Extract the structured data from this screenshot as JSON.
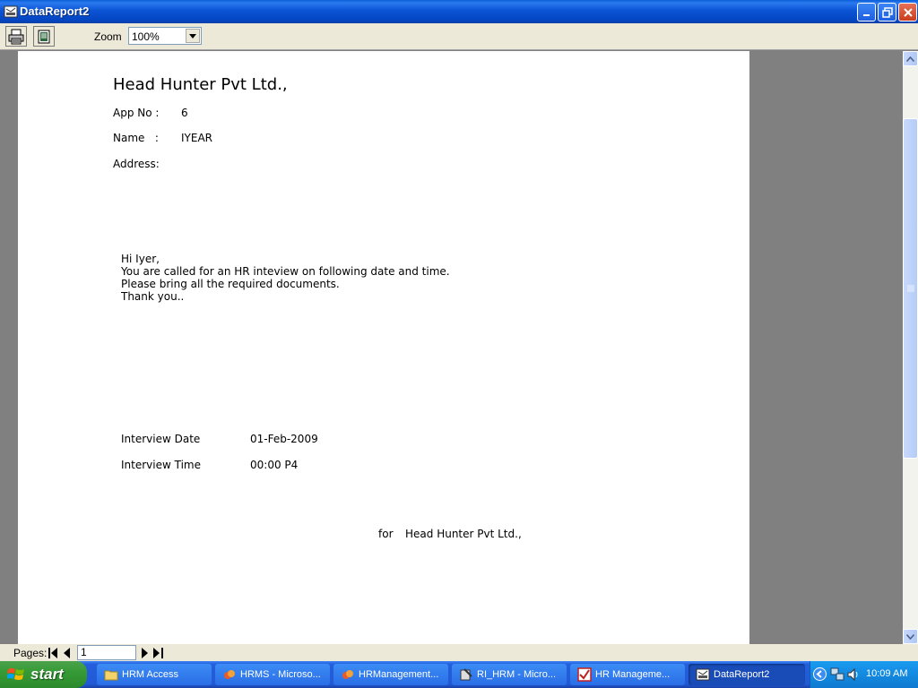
{
  "window": {
    "title": "DataReport2"
  },
  "toolbar": {
    "print_icon": "printer-icon",
    "export_icon": "export-icon",
    "zoom_label": "Zoom",
    "zoom_value": "100%"
  },
  "report": {
    "company": "Head Hunter Pvt Ltd.,",
    "app_no_label": "App No :",
    "app_no_value": "6",
    "name_label": "Name   :",
    "name_value": "IYEAR",
    "address_label": "Address:",
    "letter": [
      "Hi Iyer,",
      "You are called for an HR inteview on following date and time.",
      "Please bring all the required documents.",
      "Thank you.."
    ],
    "interview_date_label": "Interview Date",
    "interview_date_value": "01-Feb-2009",
    "interview_time_label": "Interview Time",
    "interview_time_value": "00:00 P4",
    "signoff_for": "for",
    "signoff_company": "Head Hunter Pvt Ltd.,"
  },
  "pages_bar": {
    "label": "Pages:",
    "current_page": "1"
  },
  "taskbar": {
    "start_label": "start",
    "tasks": [
      {
        "label": "HRM Access",
        "icon": "folder-icon"
      },
      {
        "label": "HRMS - Microso...",
        "icon": "vb-icon"
      },
      {
        "label": "HRManagement...",
        "icon": "vb-icon"
      },
      {
        "label": "RI_HRM - Micro...",
        "icon": "tools-icon"
      },
      {
        "label": "HR Manageme...",
        "icon": "checkbox-app-icon"
      },
      {
        "label": "DataReport2",
        "icon": "report-icon"
      }
    ],
    "clock": "10:09 AM"
  },
  "colors": {
    "titlebar": "#0b54d4",
    "taskbar": "#245edb",
    "start": "#359a35",
    "toolbar": "#ece9d8",
    "report_bg": "#808080"
  }
}
